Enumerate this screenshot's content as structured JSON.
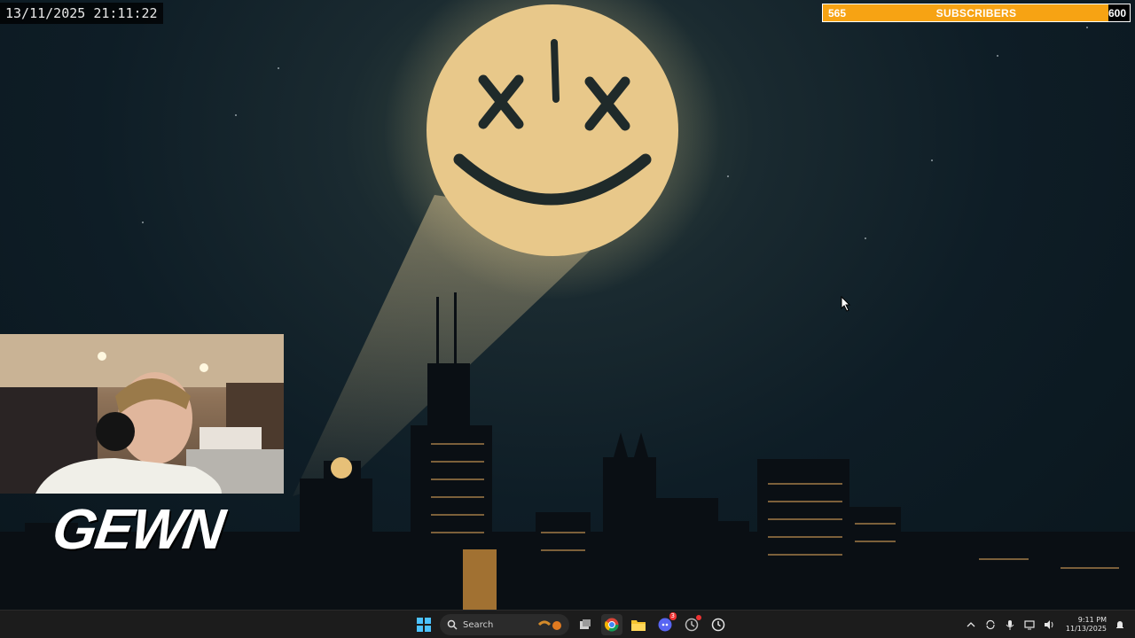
{
  "overlay": {
    "timestamp": "13/11/2025 21:11:22"
  },
  "subscriber_goal": {
    "current": "565",
    "label": "SUBSCRIBERS",
    "goal": "600",
    "progress": 0.94,
    "bar_color": "#f7a313"
  },
  "branding": {
    "logo_text": "GEWN"
  },
  "taskbar": {
    "search_placeholder": "Search",
    "clock_time": "9:11 PM",
    "clock_date": "11/13/2025",
    "pinned_apps": [
      "start-icon",
      "search-input",
      "task-view-icon",
      "chrome-icon",
      "file-explorer-icon",
      "discord-icon",
      "app-icon",
      "clock-icon"
    ],
    "discord_badge": "3"
  },
  "colors": {
    "moon": "#e8c88a",
    "beam": "#d7c08e",
    "taskbar": "#1c1c1c"
  }
}
